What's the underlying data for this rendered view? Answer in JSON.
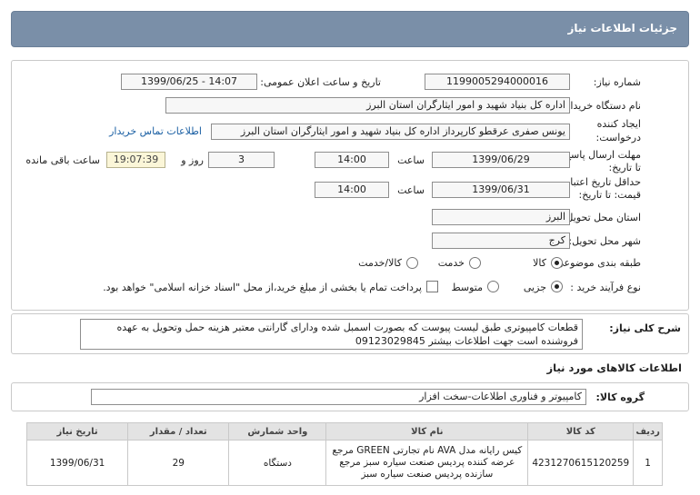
{
  "header": {
    "title": "جزئیات اطلاعات نیاز"
  },
  "fields": {
    "need_number_label": "شماره نیاز:",
    "need_number": "1199005294000016",
    "announce_label": "تاریخ و ساعت اعلان عمومی:",
    "announce_value": "1399/06/25 - 14:07",
    "buyer_label": "نام دستگاه خریدار:",
    "buyer_value": "اداره کل بنیاد شهید و امور ایثارگران استان البرز",
    "creator_label_1": "ایجاد کننده",
    "creator_label_2": "درخواست:",
    "creator_value": "یونس صفری عرقطو کارپرداز اداره کل بنیاد شهید و امور ایثارگران استان البرز",
    "contact_link": "اطلاعات تماس خریدار",
    "deadline_label_1": "مهلت ارسال پاسخ:",
    "deadline_label_2": "تا تاریخ:",
    "deadline_date": "1399/06/29",
    "time_label": "ساعت",
    "deadline_time": "14:00",
    "days_value": "3",
    "days_label": "روز و",
    "remaining_value": "19:07:39",
    "remaining_label": "ساعت باقی مانده",
    "validity_label_1": "حداقل تاریخ اعتبار",
    "validity_label_2": "قیمت: تا تاریخ:",
    "validity_date": "1399/06/31",
    "validity_time": "14:00",
    "province_label": "استان محل تحویل:",
    "province_value": "البرز",
    "city_label": "شهر محل تحویل:",
    "city_value": "کرج",
    "category_label": "طبقه بندی موضوعی:",
    "category_options": [
      "کالا",
      "خدمت",
      "کالا/خدمت"
    ],
    "process_label": "نوع فرآیند خرید :",
    "process_options": [
      "جزیی",
      "متوسط"
    ],
    "payment_note": "پرداخت تمام یا بخشی از مبلغ خرید،از محل \"اسناد خزانه اسلامی\" خواهد بود."
  },
  "description": {
    "label": "شرح کلی نیاز:",
    "text": "قطعات کامپیوتری طبق لیست پیوست که بصورت اسمبل شده ودارای گارانتی معتبر هزینه حمل وتحویل به عهده فروشنده است جهت اطلاعات بیشتر 09123029845"
  },
  "goods_section": {
    "title": "اطلاعات کالاهای مورد نیاز",
    "group_label": "گروه کالا:",
    "group_value": "کامپیوتر و فناوری اطلاعات-سخت افزار"
  },
  "table": {
    "headers": [
      "ردیف",
      "کد کالا",
      "نام کالا",
      "واحد شمارش",
      "تعداد / مقدار",
      "تاریخ نیاز"
    ],
    "rows": [
      {
        "row": "1",
        "code": "4231270615120259",
        "name": "کیس رایانه مدل AVA نام تجارتی GREEN مرجع عرضه کننده پردیس صنعت سیاره سبز مرجع سازنده پردیس صنعت سیاره سبز",
        "unit": "دستگاه",
        "qty": "29",
        "date": "1399/06/31"
      }
    ]
  }
}
